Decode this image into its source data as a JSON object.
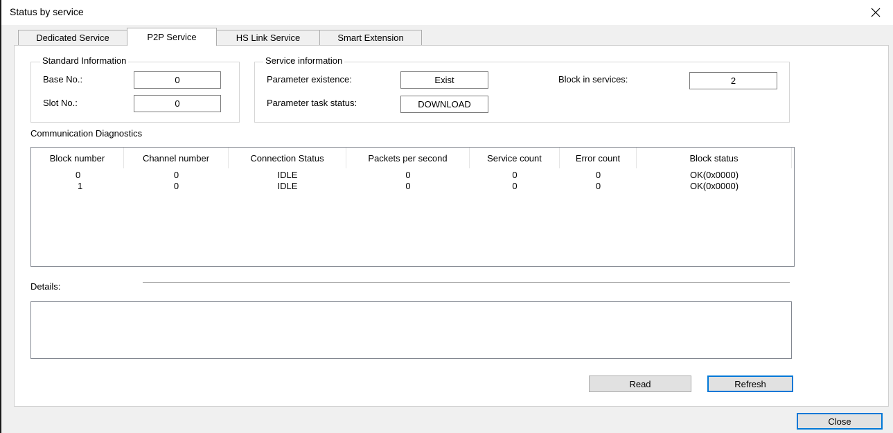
{
  "window": {
    "title": "Status by service"
  },
  "tabs": [
    {
      "label": "Dedicated Service",
      "active": false
    },
    {
      "label": "P2P Service",
      "active": true
    },
    {
      "label": "HS Link Service",
      "active": false
    },
    {
      "label": "Smart Extension",
      "active": false
    }
  ],
  "standard_info": {
    "legend": "Standard Information",
    "base_label": "Base No.:",
    "base_value": "0",
    "slot_label": "Slot No.:",
    "slot_value": "0"
  },
  "service_info": {
    "legend": "Service information",
    "param_existence_label": "Parameter existence:",
    "param_existence_value": "Exist",
    "param_task_label": "Parameter task status:",
    "param_task_value": "DOWNLOAD",
    "block_label": "Block in services:",
    "block_value": "2"
  },
  "diagnostics": {
    "label": "Communication Diagnostics",
    "columns": [
      "Block number",
      "Channel number",
      "Connection Status",
      "Packets per second",
      "Service count",
      "Error count",
      "Block status"
    ],
    "rows": [
      [
        "0",
        "0",
        "IDLE",
        "0",
        "0",
        "0",
        "OK(0x0000)"
      ],
      [
        "1",
        "0",
        "IDLE",
        "0",
        "0",
        "0",
        "OK(0x0000)"
      ]
    ]
  },
  "details": {
    "label": "Details:"
  },
  "buttons": {
    "read": "Read",
    "refresh": "Refresh",
    "close": "Close"
  },
  "icons": {
    "close": "close-icon"
  },
  "colors": {
    "accent": "#0078d7",
    "background": "#f0f0f0",
    "panel": "#ffffff"
  }
}
